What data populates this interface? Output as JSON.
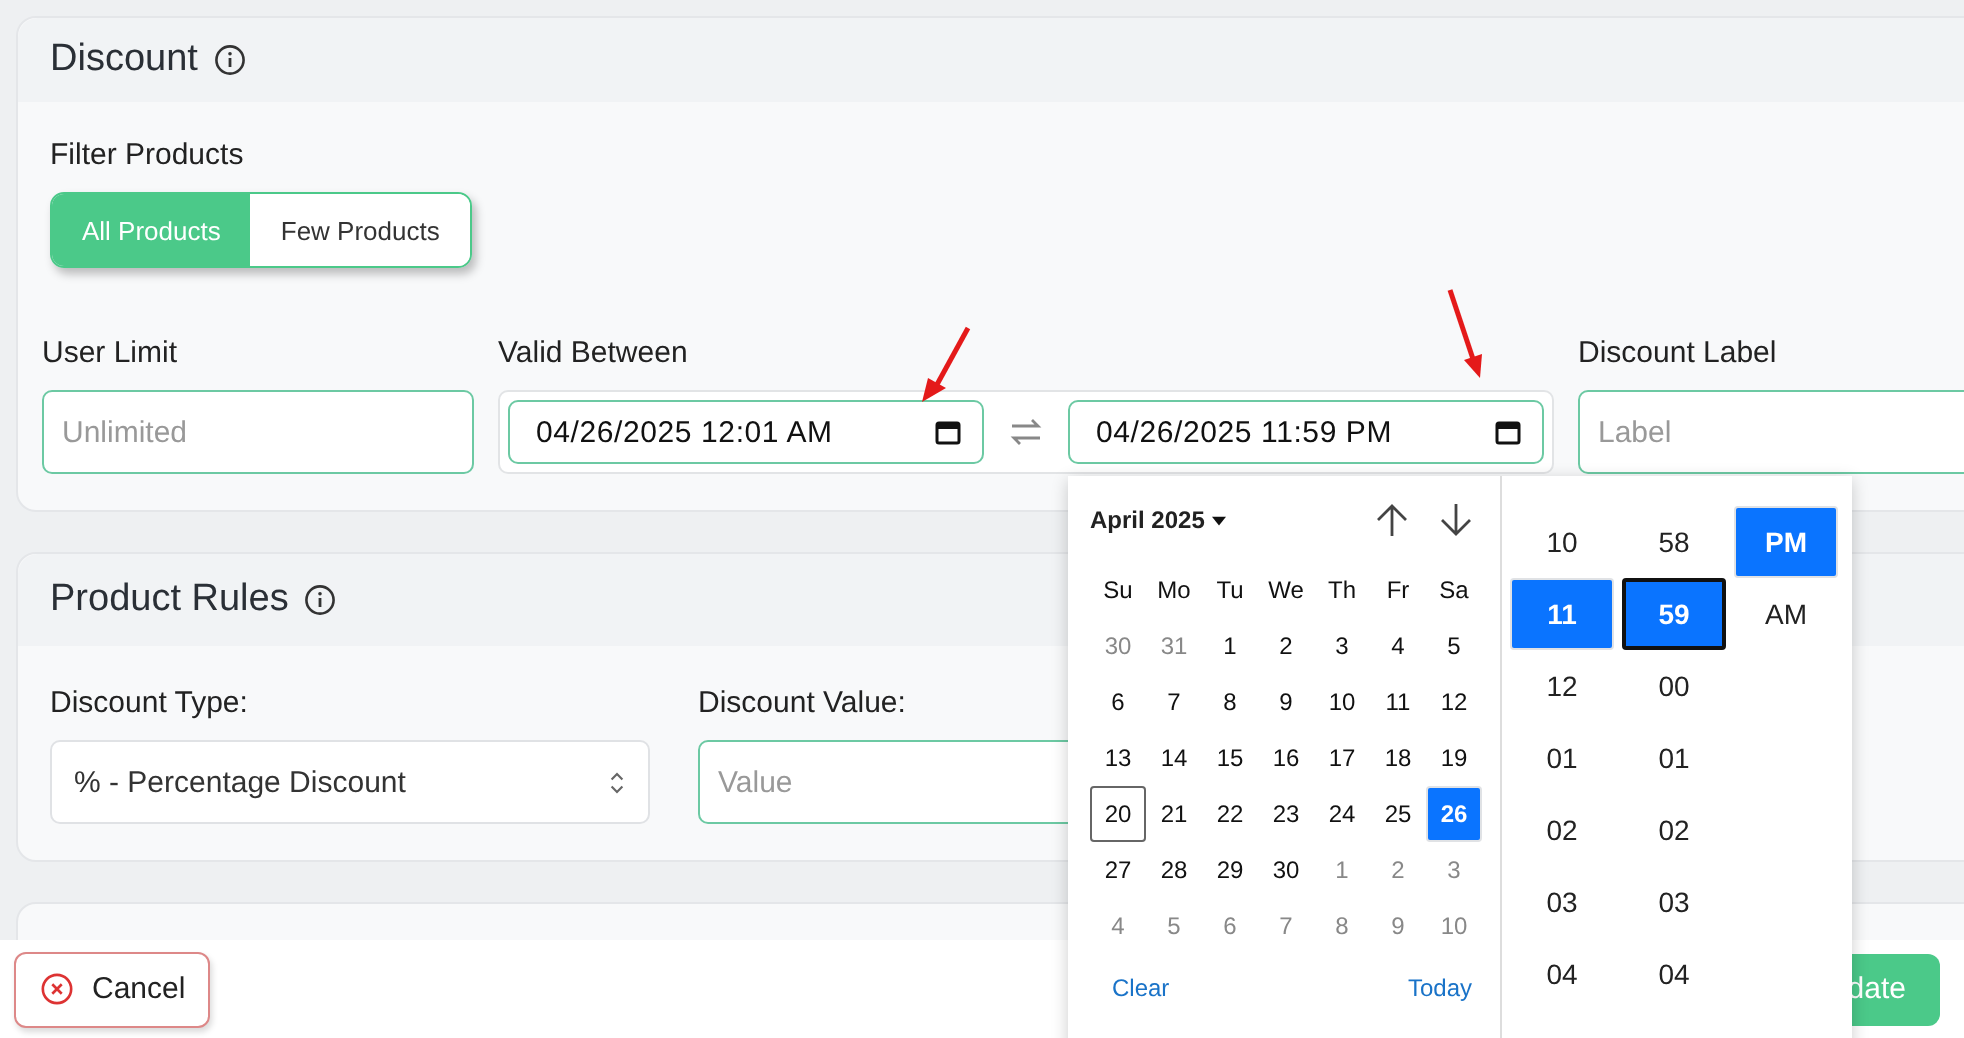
{
  "discount": {
    "title": "Discount",
    "filter_label": "Filter Products",
    "filter_options": [
      {
        "label": "All Products",
        "selected": true
      },
      {
        "label": "Few Products",
        "selected": false
      }
    ],
    "user_limit": {
      "label": "User Limit",
      "placeholder": "Unlimited"
    },
    "valid_between": {
      "label": "Valid Between",
      "start": "04/26/2025 12:01 AM",
      "end": "04/26/2025 11:59 PM"
    },
    "discount_label": {
      "label": "Discount Label",
      "placeholder": "Label"
    }
  },
  "product_rules": {
    "title": "Product Rules",
    "type_label": "Discount Type:",
    "type_value": "% - Percentage Discount",
    "value_label": "Discount Value:",
    "value_placeholder": "Value"
  },
  "footer": {
    "cancel": "Cancel",
    "update": "date"
  },
  "picker": {
    "month": "April 2025",
    "weekdays": [
      "Su",
      "Mo",
      "Tu",
      "We",
      "Th",
      "Fr",
      "Sa"
    ],
    "days": [
      {
        "label": "30",
        "muted": true,
        "selected": false,
        "today": false
      },
      {
        "label": "31",
        "muted": true,
        "selected": false,
        "today": false
      },
      {
        "label": "1",
        "muted": false,
        "selected": false,
        "today": false
      },
      {
        "label": "2",
        "muted": false,
        "selected": false,
        "today": false
      },
      {
        "label": "3",
        "muted": false,
        "selected": false,
        "today": false
      },
      {
        "label": "4",
        "muted": false,
        "selected": false,
        "today": false
      },
      {
        "label": "5",
        "muted": false,
        "selected": false,
        "today": false
      },
      {
        "label": "6",
        "muted": false,
        "selected": false,
        "today": false
      },
      {
        "label": "7",
        "muted": false,
        "selected": false,
        "today": false
      },
      {
        "label": "8",
        "muted": false,
        "selected": false,
        "today": false
      },
      {
        "label": "9",
        "muted": false,
        "selected": false,
        "today": false
      },
      {
        "label": "10",
        "muted": false,
        "selected": false,
        "today": false
      },
      {
        "label": "11",
        "muted": false,
        "selected": false,
        "today": false
      },
      {
        "label": "12",
        "muted": false,
        "selected": false,
        "today": false
      },
      {
        "label": "13",
        "muted": false,
        "selected": false,
        "today": false
      },
      {
        "label": "14",
        "muted": false,
        "selected": false,
        "today": false
      },
      {
        "label": "15",
        "muted": false,
        "selected": false,
        "today": false
      },
      {
        "label": "16",
        "muted": false,
        "selected": false,
        "today": false
      },
      {
        "label": "17",
        "muted": false,
        "selected": false,
        "today": false
      },
      {
        "label": "18",
        "muted": false,
        "selected": false,
        "today": false
      },
      {
        "label": "19",
        "muted": false,
        "selected": false,
        "today": false
      },
      {
        "label": "20",
        "muted": false,
        "selected": false,
        "today": true
      },
      {
        "label": "21",
        "muted": false,
        "selected": false,
        "today": false
      },
      {
        "label": "22",
        "muted": false,
        "selected": false,
        "today": false
      },
      {
        "label": "23",
        "muted": false,
        "selected": false,
        "today": false
      },
      {
        "label": "24",
        "muted": false,
        "selected": false,
        "today": false
      },
      {
        "label": "25",
        "muted": false,
        "selected": false,
        "today": false
      },
      {
        "label": "26",
        "muted": false,
        "selected": true,
        "today": false
      },
      {
        "label": "27",
        "muted": false,
        "selected": false,
        "today": false
      },
      {
        "label": "28",
        "muted": false,
        "selected": false,
        "today": false
      },
      {
        "label": "29",
        "muted": false,
        "selected": false,
        "today": false
      },
      {
        "label": "30",
        "muted": false,
        "selected": false,
        "today": false
      },
      {
        "label": "1",
        "muted": true,
        "selected": false,
        "today": false
      },
      {
        "label": "2",
        "muted": true,
        "selected": false,
        "today": false
      },
      {
        "label": "3",
        "muted": true,
        "selected": false,
        "today": false
      },
      {
        "label": "4",
        "muted": true,
        "selected": false,
        "today": false
      },
      {
        "label": "5",
        "muted": true,
        "selected": false,
        "today": false
      },
      {
        "label": "6",
        "muted": true,
        "selected": false,
        "today": false
      },
      {
        "label": "7",
        "muted": true,
        "selected": false,
        "today": false
      },
      {
        "label": "8",
        "muted": true,
        "selected": false,
        "today": false
      },
      {
        "label": "9",
        "muted": true,
        "selected": false,
        "today": false
      },
      {
        "label": "10",
        "muted": true,
        "selected": false,
        "today": false
      }
    ],
    "clear": "Clear",
    "today": "Today",
    "hours": [
      {
        "label": "10",
        "selected": false
      },
      {
        "label": "11",
        "selected": true
      },
      {
        "label": "12",
        "selected": false
      },
      {
        "label": "01",
        "selected": false
      },
      {
        "label": "02",
        "selected": false
      },
      {
        "label": "03",
        "selected": false
      },
      {
        "label": "04",
        "selected": false
      }
    ],
    "minutes": [
      {
        "label": "58",
        "selected": false,
        "focused": false
      },
      {
        "label": "59",
        "selected": true,
        "focused": true
      },
      {
        "label": "00",
        "selected": false,
        "focused": false
      },
      {
        "label": "01",
        "selected": false,
        "focused": false
      },
      {
        "label": "02",
        "selected": false,
        "focused": false
      },
      {
        "label": "03",
        "selected": false,
        "focused": false
      },
      {
        "label": "04",
        "selected": false,
        "focused": false
      }
    ],
    "meridiem": [
      {
        "label": "PM",
        "selected": true
      },
      {
        "label": "AM",
        "selected": false
      }
    ]
  }
}
